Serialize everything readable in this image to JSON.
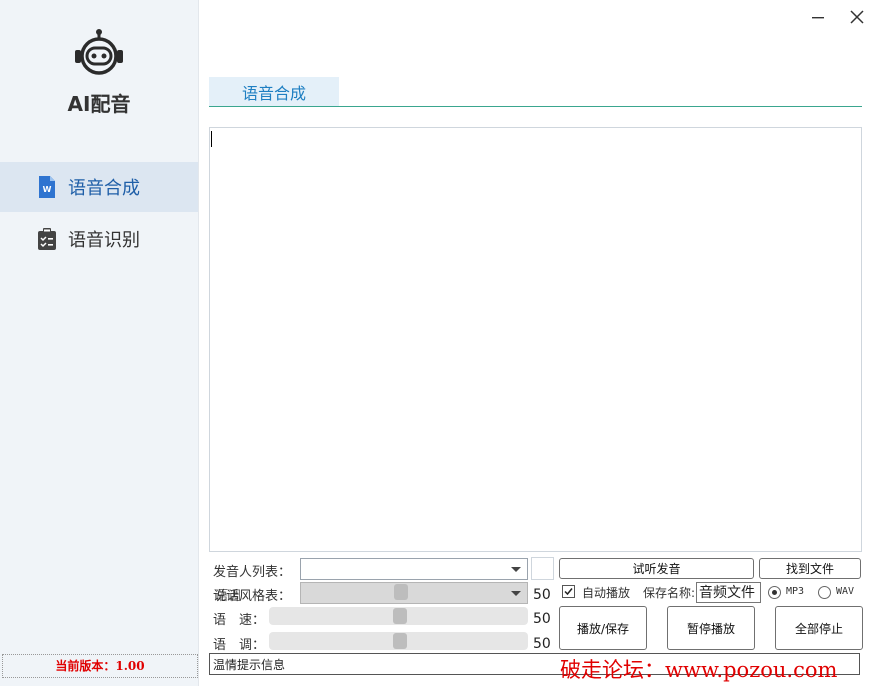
{
  "app": {
    "title": "AI配音",
    "version_label": "当前版本：1.00"
  },
  "sidebar": {
    "items": [
      {
        "label": "语音合成",
        "icon": "word-document-icon",
        "active": true
      },
      {
        "label": "语音识别",
        "icon": "clipboard-checklist-icon",
        "active": false
      }
    ]
  },
  "tabs": [
    {
      "label": "语音合成"
    }
  ],
  "editor": {
    "text": ""
  },
  "controls": {
    "speaker_label": "发音人列表：",
    "speaker_value": "",
    "style_label": "说话风格表：",
    "style_label_overlap": "语调",
    "style_value": "",
    "style_number": "50",
    "speed_label": "语　速：",
    "speed_value": 0.5,
    "speed_number": "50",
    "pitch_label": "语　调：",
    "pitch_value": 0.5,
    "pitch_number": "50",
    "preview_button": "试听发音",
    "find_file_button": "找到文件",
    "auto_play_label": "自动播放",
    "auto_play_checked": true,
    "save_name_label": "保存名称:",
    "save_name_value": "音频文件",
    "format_options": [
      "MP3",
      "WAV"
    ],
    "format_selected": "MP3",
    "play_save_button": "播放/保存",
    "pause_button": "暂停播放",
    "stop_all_button": "全部停止"
  },
  "status": {
    "text": "温情提示信息"
  },
  "watermark": "破走论坛：www.pozou.com",
  "colors": {
    "accent": "#1e7fc2",
    "tab_line": "#3aa68f",
    "version_red": "#e00000"
  }
}
